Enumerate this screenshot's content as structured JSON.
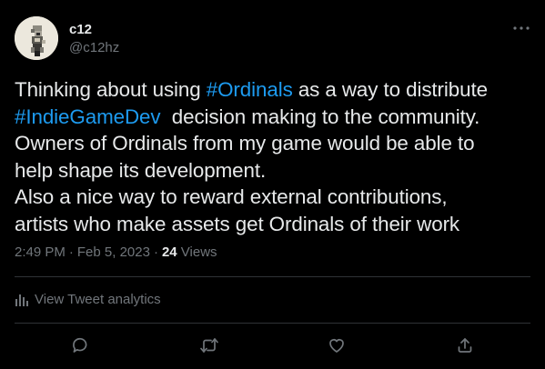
{
  "author": {
    "name": "c12",
    "handle": "@c12hz"
  },
  "tweet": {
    "lines": [
      [
        {
          "text": "Thinking about using ",
          "hashtag": false
        },
        {
          "text": "#Ordinals",
          "hashtag": true
        },
        {
          "text": " as a way to distribute",
          "hashtag": false
        }
      ],
      [
        {
          "text": "#IndieGameDev",
          "hashtag": true
        },
        {
          "text": "  decision making to the community.",
          "hashtag": false
        }
      ],
      [
        {
          "text": "Owners of Ordinals from my game would be able to",
          "hashtag": false
        }
      ],
      [
        {
          "text": "help shape its development.",
          "hashtag": false
        }
      ],
      [
        {
          "text": "Also a nice way to reward external contributions,",
          "hashtag": false
        }
      ],
      [
        {
          "text": "artists who make assets get Ordinals of their work",
          "hashtag": false
        }
      ]
    ]
  },
  "meta": {
    "time": "2:49 PM",
    "separator": "·",
    "date": "Feb 5, 2023",
    "views_count": "24",
    "views_label": "Views"
  },
  "analytics": {
    "label": "View Tweet analytics"
  },
  "colors": {
    "background": "#000000",
    "text": "#e7e9ea",
    "muted": "#71767b",
    "hashtag": "#1d9bf0",
    "divider": "#2f3336"
  },
  "icons": {
    "more": "more-dots-icon",
    "analytics": "bar-chart-icon",
    "reply": "reply-bubble-icon",
    "retweet": "retweet-icon",
    "like": "heart-icon",
    "share": "share-upload-icon"
  }
}
